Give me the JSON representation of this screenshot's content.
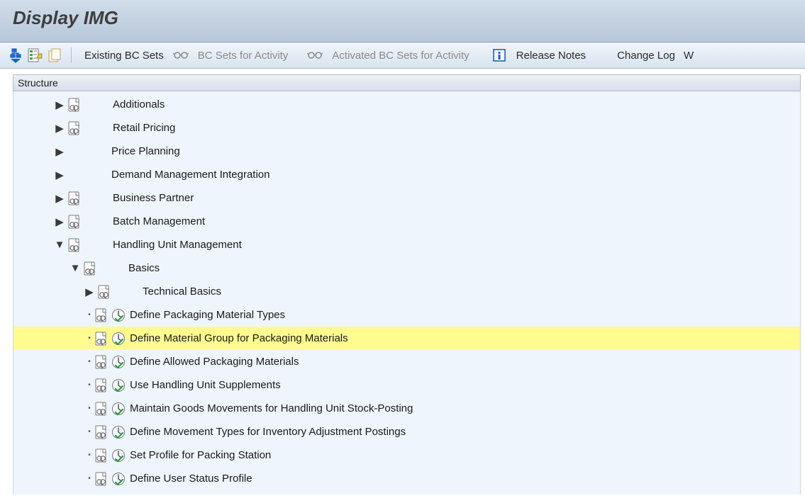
{
  "header": {
    "title": "Display IMG"
  },
  "toolbar": {
    "existing_bc_sets": "Existing BC Sets",
    "bc_sets_for_activity": "BC Sets for Activity",
    "activated_bc_sets": "Activated BC Sets for Activity",
    "release_notes": "Release Notes",
    "change_log": "Change Log",
    "where_used_cut": "W"
  },
  "structure_header": "Structure",
  "nodes": {
    "n0": "Additionals",
    "n1": "Retail Pricing",
    "n2": "Price Planning",
    "n3": "Demand Management Integration",
    "n4": "Business Partner",
    "n5": "Batch Management",
    "n6": "Handling Unit Management",
    "n7": "Basics",
    "n8": "Technical Basics",
    "n9": "Define Packaging Material Types",
    "n10": "Define Material Group for Packaging Materials",
    "n11": "Define Allowed Packaging Materials",
    "n12": "Use Handling Unit Supplements",
    "n13": "Maintain Goods Movements for Handling Unit Stock-Posting",
    "n14": "Define Movement Types for Inventory Adjustment Postings",
    "n15": "Set Profile for Packing Station",
    "n16": "Define User Status Profile"
  }
}
